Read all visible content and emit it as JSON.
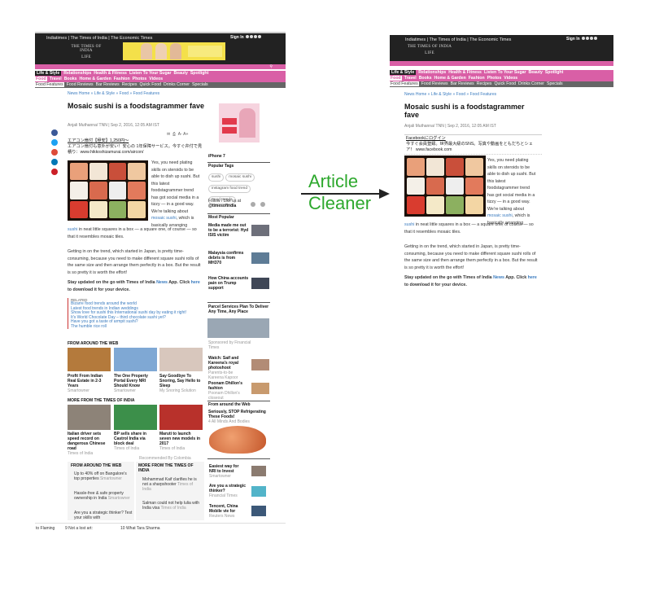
{
  "arrow_label_line1": "Article",
  "arrow_label_line2": "Cleaner",
  "left": {
    "header_links": "Indiatimes | The Times of India | The Economic Times",
    "logo_line1": "THE TIMES OF INDIA",
    "logo_line2": "LIFE",
    "signin": "Sign In",
    "nav_row1": [
      "Life & Style",
      "Relationships",
      "Health & Fitness",
      "Listen To Your Sugar",
      "Beauty",
      "Spotlight"
    ],
    "nav_row2": [
      "Food",
      "Travel",
      "Books",
      "Home & Garden",
      "Fashion",
      "Photos",
      "Videos"
    ],
    "nav_row3": [
      "Food Features",
      "Food Reviews",
      "Bar Reviews",
      "Recipes",
      "Quick Food",
      "Drinks Corner",
      "Specials"
    ],
    "breadcrumb": "News Home » Life & Style » Food » Food Features",
    "title": "Mosaic sushi is a foodstagrammer fave",
    "byline": "Anjali Muthanna/ TNN | Sep 2, 2016, 12:05 AM IST",
    "ad_line1": "エアコン扇付【極安】1,250円～",
    "ad_line2": "エアコン扇付も意外が安い！安心の 1年保障サービス。今すぐ弁付で見積り：www.hikkoshizamurai.com/aircon/",
    "para1": "Yes, you need plating skills on steroids to be able to dish up sushi. But this latest foodstagrammer trend has got social media in a tizzy — in a good way. We're talking about",
    "para1_link": "mosaic sushi",
    "para1_end": ", which is basically arranging",
    "para1_link2": "sushi",
    "para1_tail": "in neat little squares in a box — a square one, of course — so that it resembles mosaic tiles.",
    "para2": "Getting in on the trend, which started in Japan, is pretty time-consuming, because you need to make different square sushi rolls of the same size and then arrange them perfectly in a box. But the result is so pretty it is worth the effort!",
    "para3a": "Stay updated on the go with Times of India",
    "para3_link1": "News",
    "para3b": "App. Click",
    "para3_link2": "here",
    "para3c": "to download it for your device.",
    "related_label": "RELATED",
    "related": [
      "Bizarre food trends around the world",
      "Latest food trends in Indian weddings",
      "Show love for sushi this International sushi day by eating it right!",
      "It's World Chocolate Day – third chocolate sushi yet?",
      "Have you got a taste of armpit sushi?",
      "The humble rice roll"
    ],
    "from_web_label": "FROM AROUND THE WEB",
    "from_web": [
      {
        "title": "Profit From Indian Real Estate in 2-3 Years",
        "source": "Smartowner"
      },
      {
        "title": "The One Property Portal Every NRI Should Know",
        "source": "Smartowner"
      },
      {
        "title": "Say Goodbye To Snoring, Say Hello to Sleep",
        "source": "My Snoring Solution"
      }
    ],
    "more_label": "MORE FROM THE TIMES OF INDIA",
    "more": [
      {
        "title": "Italian driver sets speed record on dangerous Chinese road",
        "source": "Times of India"
      },
      {
        "title": "BP sells share in Castrol India via block deal",
        "source": "Times of India"
      },
      {
        "title": "Maruti to launch seven new models in 2017",
        "source": "Times of India"
      }
    ],
    "recommended": "Recommended By Colombia",
    "col2_label": "FROM AROUND THE WEB",
    "col2": [
      {
        "text": "Up to 40% off on Bangalore's top properties",
        "src": "Smartowner"
      },
      {
        "text": "Hassle-free & safe property ownership in India",
        "src": "Smartowner"
      },
      {
        "text": "Are you a strategic thinker? Test your skills with",
        "src": ""
      }
    ],
    "col3_label": "MORE FROM THE TIMES OF INDIA",
    "col3": [
      {
        "text": "Mohammad Kaif clarifies he is not a sharpshooter",
        "src": "Times of India"
      },
      {
        "text": "Salman could not help lulia with India visa",
        "src": "Times of India"
      }
    ],
    "bottom_items": [
      "to Flaming",
      "9  Not a lost art:",
      "10  What Tara Sharma"
    ],
    "sidebar": {
      "iphone": "iPhone 7",
      "popular_tags_label": "Popular Tags",
      "tags": [
        "sushi",
        "mosaic sushi",
        "instagram food trend",
        "Food trends"
      ],
      "follow": "Follow / Like us at",
      "handle": "@timesofindia",
      "most_popular": "Most Popular",
      "popular": [
        "Media made me out to be a terrorist: Hyd ISIS victim",
        "Malaysia confirms debris is from MH370",
        "How China accounts pain on Trump support"
      ],
      "parcel": "Parcel Services Plan To Deliver Any Time, Any Place",
      "sponsored": "Sponsored by Financial Times",
      "watch": "Watch: Saif and Kareena's royal photoshoot",
      "watch_src": "Parents-to-be Kareena Kapoor",
      "poonam": "Poonam Dhillon's fashion",
      "poonam_src": "Poonam Dhillon's closeout",
      "from_web": "From around the Web",
      "seriously": "Seriously, STOP Refrigerating These Foods!",
      "seriously_src": "4 All Minds And Bodies",
      "easiest": "Easiest way for NRI to Invest",
      "easiest_src": "Smartowner",
      "strategic": "Are you a strategic thinker?",
      "strategic_src": "Financial Times",
      "tencent": "Tencent, China Mobile vie for",
      "tencent_src": "Reuters News"
    }
  },
  "right": {
    "header_links": "Indiatimes | The Times of India | The Economic Times",
    "logo_line1": "THE TIMES OF INDIA",
    "logo_line2": "LIFE",
    "signin": "Sign In",
    "nav_row1": [
      "Life & Style",
      "Relationships",
      "Health & Fitness",
      "Listen To Your Sugar",
      "Beauty",
      "Spotlight"
    ],
    "nav_row2": [
      "Food",
      "Travel",
      "Books",
      "Home & Garden",
      "Fashion",
      "Photos",
      "Videos"
    ],
    "nav_row3": [
      "Food Features",
      "Food Reviews",
      "Bar Reviews",
      "Recipes",
      "Quick Food",
      "Drinks Corner",
      "Specials"
    ],
    "breadcrumb": "News Home » Life & Style » Food » Food Features",
    "title": "Mosaic sushi is a foodstagrammer fave",
    "byline": "Anjali Muthanna/ TNN | Sep 2, 2016, 12:05 AM IST",
    "ad_line1": "Facebookにログイン",
    "ad_line2": "今すぐ会員登録。世界最大級のSNS。写真や動画をともだちとシェア！ www.facebook.com",
    "para1": "Yes, you need plating skills on steroids to be able to dish up sushi. But this latest foodstagrammer trend has got social media in a tizzy — in a good way. We're talking about",
    "para1_link": "mosaic sushi",
    "para1_end": ", which is basically arranging",
    "para1_link2": "sushi",
    "para1_tail": "in neat little squares in a box — a square one, of course — so that it resembles mosaic tiles.",
    "para2": "Getting in on the trend, which started in Japan, is pretty time-consuming, because you need to make different square sushi rolls of the same size and then arrange them perfectly in a box. But the result is so pretty it is worth the effort!",
    "para3a": "Stay updated on the go with Times of India",
    "para3_link1": "News",
    "para3b": "App. Click",
    "para3_link2": "here",
    "para3c": "to download it for your device."
  }
}
